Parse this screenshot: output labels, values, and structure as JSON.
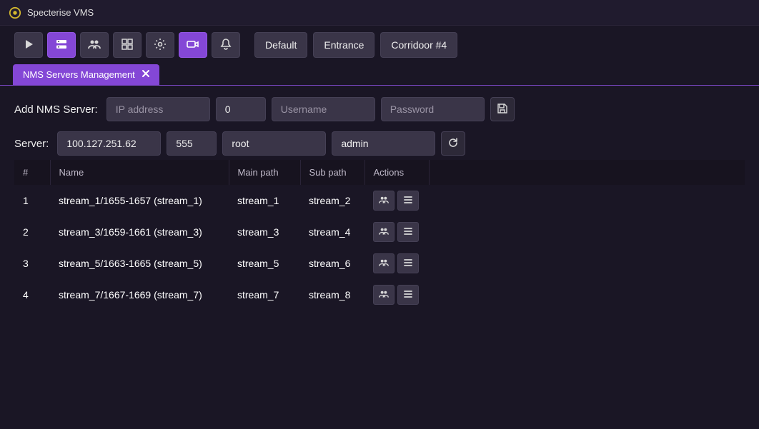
{
  "app": {
    "title": "Specterise VMS"
  },
  "toolbar": {
    "buttons": [
      {
        "name": "play-button",
        "icon": "play-icon",
        "active": false
      },
      {
        "name": "servers-button",
        "icon": "servers-icon",
        "active": true
      },
      {
        "name": "users-button",
        "icon": "users-icon",
        "active": false
      },
      {
        "name": "grid-button",
        "icon": "grid-icon",
        "active": false
      },
      {
        "name": "settings-button",
        "icon": "gear-icon",
        "active": false
      },
      {
        "name": "camera-button",
        "icon": "camera-icon",
        "active": true
      },
      {
        "name": "notifications-button",
        "icon": "bell-icon",
        "active": false
      }
    ],
    "quick": [
      {
        "label": "Default"
      },
      {
        "label": "Entrance"
      },
      {
        "label": "Corridoor #4"
      }
    ]
  },
  "tab": {
    "label": "NMS Servers Management"
  },
  "add_server": {
    "label": "Add NMS Server:",
    "ip_placeholder": "IP address",
    "port_value": "0",
    "user_placeholder": "Username",
    "pass_placeholder": "Password"
  },
  "server": {
    "label": "Server:",
    "ip": "100.127.251.62",
    "port": "555",
    "user": "root",
    "pass": "admin"
  },
  "table": {
    "headers": {
      "num": "#",
      "name": "Name",
      "main": "Main path",
      "sub": "Sub path",
      "act": "Actions"
    },
    "rows": [
      {
        "num": "1",
        "name": "stream_1/1655-1657 (stream_1)",
        "main": "stream_1",
        "sub": "stream_2"
      },
      {
        "num": "2",
        "name": "stream_3/1659-1661 (stream_3)",
        "main": "stream_3",
        "sub": "stream_4"
      },
      {
        "num": "3",
        "name": "stream_5/1663-1665 (stream_5)",
        "main": "stream_5",
        "sub": "stream_6"
      },
      {
        "num": "4",
        "name": "stream_7/1667-1669 (stream_7)",
        "main": "stream_7",
        "sub": "stream_8"
      }
    ]
  }
}
